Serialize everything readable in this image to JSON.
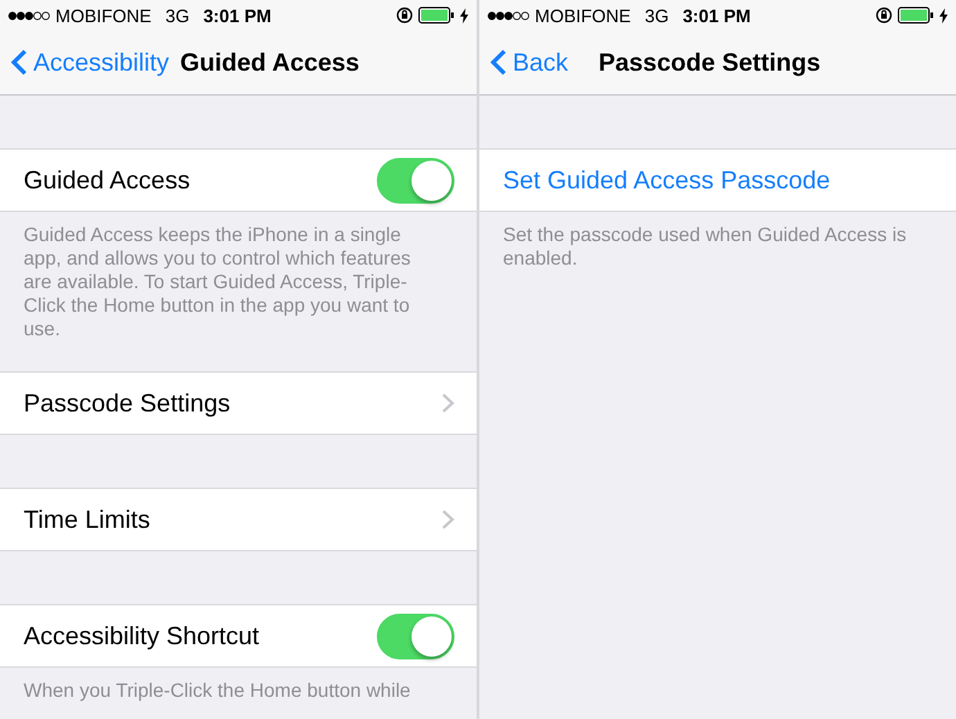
{
  "screens": [
    {
      "status_bar": {
        "carrier": "MOBIFONE",
        "network": "3G",
        "time": "3:01 PM",
        "charging": true
      },
      "nav_bar": {
        "back": "Accessibility",
        "title": "Guided Access"
      },
      "sections": [
        {
          "rows": [
            {
              "kind": "toggle",
              "label": "Guided Access",
              "on": true
            }
          ],
          "footer": "Guided Access keeps the iPhone in a single app, and allows you to control which features are available. To start Guided Access, Triple-Click the Home button in the app you want to use."
        },
        {
          "rows": [
            {
              "kind": "disclosure",
              "label": "Passcode Settings"
            }
          ]
        },
        {
          "rows": [
            {
              "kind": "disclosure",
              "label": "Time Limits"
            }
          ]
        },
        {
          "rows": [
            {
              "kind": "toggle",
              "label": "Accessibility Shortcut",
              "on": true
            }
          ],
          "footer": "When you Triple-Click the Home button while"
        }
      ]
    },
    {
      "status_bar": {
        "carrier": "MOBIFONE",
        "network": "3G",
        "time": "3:01 PM",
        "charging": true
      },
      "nav_bar": {
        "back": "Back",
        "title": "Passcode Settings"
      },
      "sections": [
        {
          "rows": [
            {
              "kind": "action",
              "label": "Set Guided Access Passcode"
            }
          ],
          "footer": "Set the passcode used when Guided Access is enabled."
        }
      ]
    }
  ]
}
